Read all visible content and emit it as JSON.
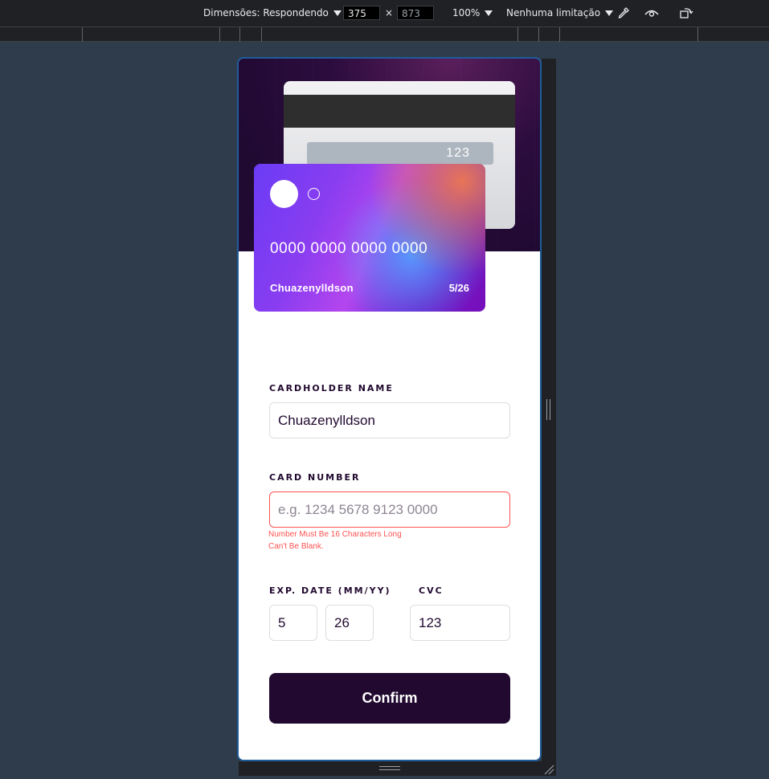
{
  "devtools": {
    "dimensions_label": "Dimensões: Respondendo",
    "width": "375",
    "times": "×",
    "height": "873",
    "zoom": "100%",
    "throttling": "Nenhuma limitação",
    "icons": [
      "eyedropper-icon",
      "vision-icon",
      "rotate-icon"
    ]
  },
  "card": {
    "back_cvc": "123",
    "number": "0000 0000 0000 0000",
    "holder": "Chuazenylldson",
    "expiry": "5/26"
  },
  "form": {
    "cardholder_label": "CARDHOLDER NAME",
    "cardholder_value": "Chuazenylldson",
    "number_label": "CARD NUMBER",
    "number_value": "",
    "number_placeholder": "e.g. 1234 5678 9123 0000",
    "number_error_1": "Number Must Be 16 Characters Long",
    "number_error_2": "Can't Be Blank.",
    "exp_label": "EXP. DATE (MM/YY)",
    "exp_month": "5",
    "exp_year": "26",
    "cvc_label": "CVC",
    "cvc_value": "123",
    "confirm_label": "Confirm"
  },
  "colors": {
    "accent_dark": "#21092f",
    "error": "#ff5252",
    "devtools_bg": "#202124",
    "page_bg": "#2f3c4c"
  }
}
